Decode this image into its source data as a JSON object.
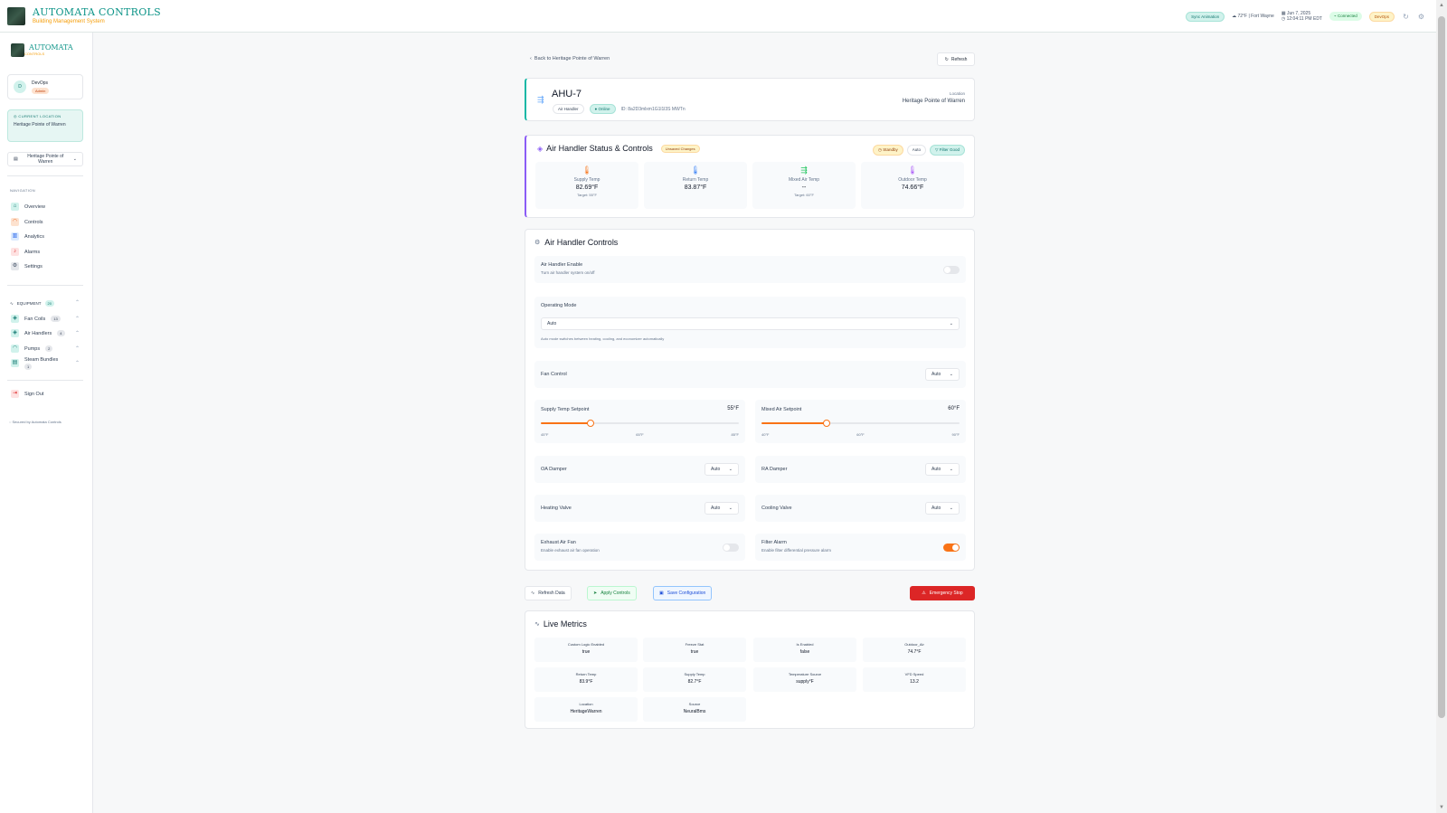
{
  "header": {
    "brand_title": "AUTOMATA CONTROLS",
    "brand_subtitle": "Building Management System",
    "sync_pill": "Sync Animation",
    "weather": "72°F | Fort Wayne",
    "date": "Jun 7, 2025",
    "time": "12:04:11 PM EDT",
    "connection": "Connected",
    "role_badge": "DevOps"
  },
  "sidebar": {
    "logo_title": "AUTOMATA",
    "logo_subtitle": "CONTROLS",
    "user_initial": "D",
    "user_name": "DevOps",
    "user_role": "Admin",
    "current_location_heading": "CURRENT LOCATION",
    "current_location_value": "Heritage Pointe of Warren",
    "location_select": "Heritage Pointe of Warren",
    "navigation_heading": "NAVIGATION",
    "nav": [
      "Overview",
      "Controls",
      "Analytics",
      "Alarms",
      "Settings"
    ],
    "equipment_heading": "EQUIPMENT",
    "equipment_count": "20",
    "equipment": [
      {
        "label": "Fan Coils",
        "count": "13"
      },
      {
        "label": "Air Handlers",
        "count": "4"
      },
      {
        "label": "Pumps",
        "count": "2"
      },
      {
        "label": "Steam Bundles",
        "count": "1"
      }
    ],
    "sign_out": "Sign Out",
    "footer": "Secured by Automata Controls"
  },
  "page": {
    "back_link": "Back to Heritage Pointe of Warren",
    "refresh": "Refresh"
  },
  "equipment_card": {
    "name": "AHU-7",
    "type_chip": "Air Handler",
    "status_chip": "Online",
    "id_text": "ID: 8a2D3mlxm1G1l1l3S MWTn",
    "location_label": "Location",
    "location_value": "Heritage Pointe of Warren"
  },
  "status": {
    "title": "Air Handler Status & Controls",
    "unsaved": "Unsaved Changes",
    "badges": [
      "Standby",
      "Auto",
      "Filter Good"
    ],
    "tiles": [
      {
        "label": "Supply Temp",
        "value": "82.69°F",
        "target": "Target: 55°F"
      },
      {
        "label": "Return Temp",
        "value": "83.87°F",
        "target": ""
      },
      {
        "label": "Mixed Air Temp",
        "value": "--",
        "target": "Target: 60°F"
      },
      {
        "label": "Outdoor Temp",
        "value": "74.66°F",
        "target": ""
      }
    ]
  },
  "controls": {
    "title": "Air Handler Controls",
    "enable_label": "Air Handler Enable",
    "enable_sub": "Turn air handler system on/off",
    "enable_on": false,
    "operating_mode_label": "Operating Mode",
    "operating_mode_value": "Auto",
    "operating_mode_note": "Auto mode switches between heating, cooling, and economizer automatically",
    "fan_control_label": "Fan Control",
    "fan_control_value": "Auto",
    "supply_setpoint_label": "Supply Temp Setpoint",
    "supply_setpoint_value": "55°F",
    "supply_setpoint_fraction": 0.25,
    "supply_ticks": [
      "45°F",
      "65°F",
      "85°F"
    ],
    "mixed_setpoint_label": "Mixed Air Setpoint",
    "mixed_setpoint_value": "60°F",
    "mixed_setpoint_fraction": 0.33,
    "mixed_ticks": [
      "40°F",
      "60°F",
      "90°F"
    ],
    "oa_damper_label": "OA Damper",
    "oa_damper_value": "Auto",
    "ra_damper_label": "RA Damper",
    "ra_damper_value": "Auto",
    "heating_valve_label": "Heating Valve",
    "heating_valve_value": "Auto",
    "cooling_valve_label": "Cooling Valve",
    "cooling_valve_value": "Auto",
    "exhaust_label": "Exhaust Air Fan",
    "exhaust_sub": "Enable exhaust air fan operation",
    "exhaust_on": false,
    "filter_alarm_label": "Filter Alarm",
    "filter_alarm_sub": "Enable filter differential pressure alarm",
    "filter_alarm_on": true
  },
  "actions": {
    "refresh_data": "Refresh Data",
    "apply_controls": "Apply Controls",
    "save_configuration": "Save Configuration",
    "emergency_stop": "Emergency Stop"
  },
  "metrics": {
    "title": "Live Metrics",
    "items": [
      {
        "key": "Custom Logic Enabled",
        "value": "true"
      },
      {
        "key": "Freeze Stat",
        "value": "true"
      },
      {
        "key": "Is Enabled",
        "value": "false"
      },
      {
        "key": "Outdoor_Air",
        "value": "74.7°F"
      },
      {
        "key": "Return Temp",
        "value": "83.9°F"
      },
      {
        "key": "Supply Temp",
        "value": "82.7°F"
      },
      {
        "key": "Temperature Source",
        "value": "supply°F"
      },
      {
        "key": "VFD Speed",
        "value": "13.2"
      },
      {
        "key": "Location",
        "value": "HeritageWarren"
      },
      {
        "key": "Source",
        "value": "NeuralBms"
      }
    ]
  },
  "colors": {
    "accent": "#0d9488",
    "orange": "#f97316",
    "danger": "#dc2626",
    "purple": "#8b5cf6"
  }
}
